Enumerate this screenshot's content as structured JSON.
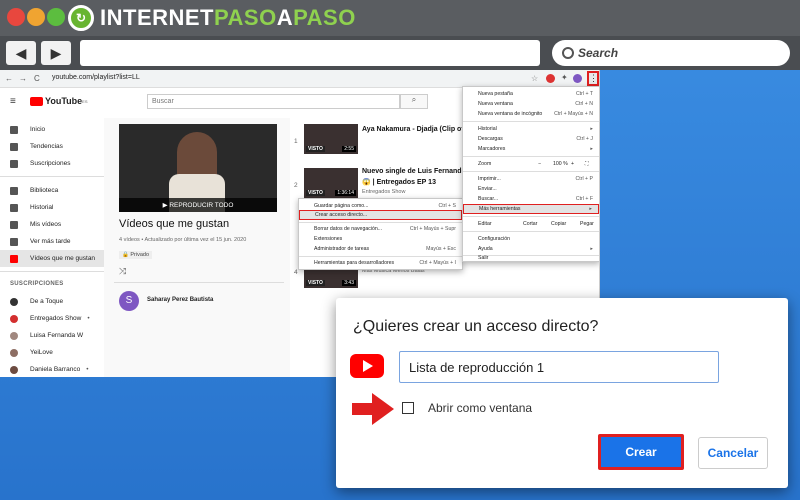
{
  "colors": {
    "accent_red": "#e02020",
    "primary_blue": "#1a73e8",
    "youtube_red": "#ff0000"
  },
  "site_logo": {
    "part1": "INTERNET",
    "part2": "PASO",
    "part3": "A",
    "part4": "PASO"
  },
  "outer_browser": {
    "back_icon": "◀",
    "forward_icon": "▶",
    "search_placeholder": "Search"
  },
  "chrome": {
    "nav_back": "←",
    "nav_forward": "→",
    "reload": "C",
    "url": "youtube.com/playlist?list=LL",
    "menu_icon": "⋮"
  },
  "youtube": {
    "logo_text": "YouTube",
    "logo_sup": "ES",
    "search_placeholder": "Buscar",
    "sidebar": {
      "items": [
        {
          "label": "Inicio"
        },
        {
          "label": "Tendencias"
        },
        {
          "label": "Suscripciones"
        },
        {
          "label": "Biblioteca"
        },
        {
          "label": "Historial"
        },
        {
          "label": "Mis vídeos"
        },
        {
          "label": "Ver más tarde"
        },
        {
          "label": "Vídeos que me gustan"
        }
      ],
      "subs_heading": "SUSCRIPCIONES",
      "channels": [
        {
          "label": "De a Toque"
        },
        {
          "label": "Entregados Show"
        },
        {
          "label": "Luisa Fernanda W"
        },
        {
          "label": "YeiLove"
        },
        {
          "label": "Daniela Barranco"
        }
      ]
    },
    "playlist": {
      "play_all": "▶ REPRODUCIR TODO",
      "title": "Vídeos que me gustan",
      "meta": "4 vídeos • Actualizado por última vez el 15 jun. 2020",
      "privacy": "🔒 Privado",
      "shuffle_icon": "⤨",
      "owner_initial": "S",
      "owner": "Saharay Perez Bautista"
    },
    "videos": [
      {
        "num": "1",
        "tag": "VISTO",
        "duration": "2:55",
        "title": "Aya Nakamura - Djadja (Clip offi",
        "sub": ""
      },
      {
        "num": "2",
        "tag": "VISTO",
        "duration": "1:36:14",
        "title": "Nuevo single de Luis Fernando:",
        "title2": "😱 | Entregados EP 13",
        "sub": "Entregados Show"
      },
      {
        "num": "4",
        "tag": "VISTO",
        "duration": "3:43",
        "title": "",
        "sub": "Más Música Menos Balas"
      }
    ]
  },
  "main_menu": [
    {
      "label": "Nueva pestaña",
      "shortcut": "Ctrl + T"
    },
    {
      "label": "Nueva ventana",
      "shortcut": "Ctrl + N"
    },
    {
      "label": "Nueva ventana de incógnito",
      "shortcut": "Ctrl + Mayús + N"
    },
    {
      "label": "Historial",
      "shortcut": "▸"
    },
    {
      "label": "Descargas",
      "shortcut": "Ctrl + J"
    },
    {
      "label": "Marcadores",
      "shortcut": "▸"
    },
    {
      "label": "Zoom",
      "shortcut": ""
    },
    {
      "label": "Imprimir...",
      "shortcut": "Ctrl + P"
    },
    {
      "label": "Enviar...",
      "shortcut": ""
    },
    {
      "label": "Buscar...",
      "shortcut": "Ctrl + F"
    },
    {
      "label": "Más herramientas",
      "shortcut": "▸"
    },
    {
      "label": "Editar",
      "shortcut": ""
    },
    {
      "label": "Configuración",
      "shortcut": ""
    },
    {
      "label": "Ayuda",
      "shortcut": "▸"
    },
    {
      "label": "Salir",
      "shortcut": ""
    }
  ],
  "zoom_controls": {
    "minus": "−",
    "value": "100 %",
    "plus": "+",
    "fullscreen": "⛶"
  },
  "edit_controls": {
    "cut": "Cortar",
    "copy": "Copiar",
    "paste": "Pegar"
  },
  "sub_menu": [
    {
      "label": "Guardar página como...",
      "shortcut": "Ctrl + S"
    },
    {
      "label": "Crear acceso directo...",
      "shortcut": ""
    },
    {
      "label": "Borrar datos de navegación...",
      "shortcut": "Ctrl + Mayús + Supr"
    },
    {
      "label": "Extensiones",
      "shortcut": ""
    },
    {
      "label": "Administrador de tareas",
      "shortcut": "Mayús + Esc"
    },
    {
      "label": "Herramientas para desarrolladores",
      "shortcut": "Ctrl + Mayús + I"
    }
  ],
  "dialog": {
    "title": "¿Quieres crear un acceso directo?",
    "input_value": "Lista de reproducción 1",
    "checkbox_label": "Abrir como ventana",
    "create_label": "Crear",
    "cancel_label": "Cancelar"
  }
}
